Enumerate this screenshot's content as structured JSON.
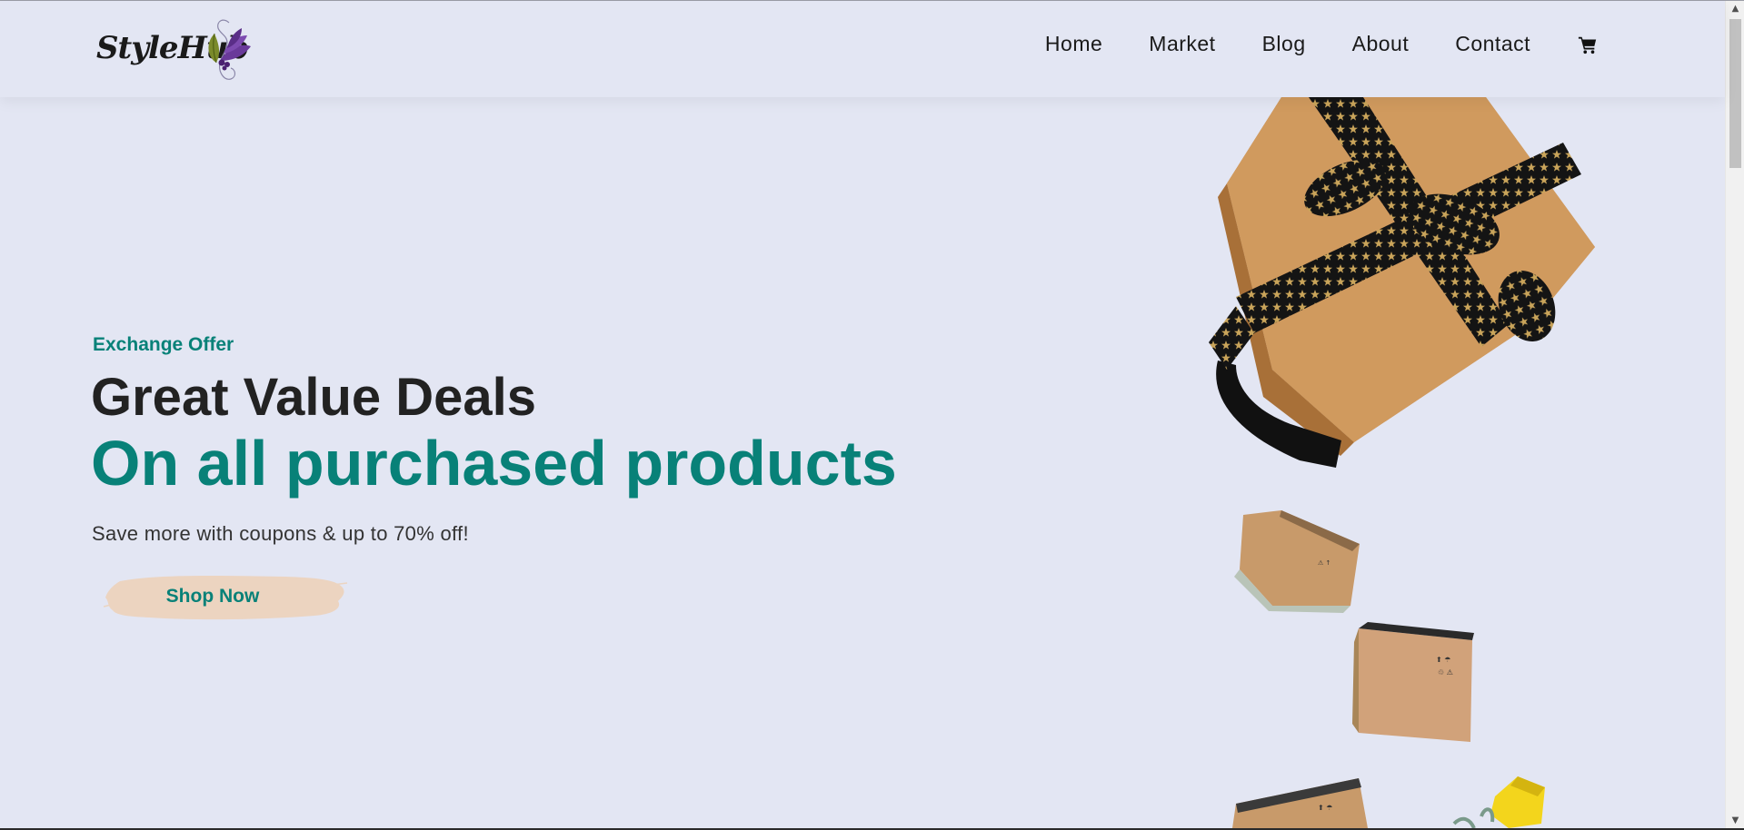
{
  "brand": {
    "logo_text": "StyleHub"
  },
  "nav": {
    "items": [
      {
        "label": "Home"
      },
      {
        "label": "Market"
      },
      {
        "label": "Blog"
      },
      {
        "label": "About"
      },
      {
        "label": "Contact"
      }
    ],
    "cart_icon": "shopping-cart-icon"
  },
  "hero": {
    "subtitle": "Exchange Offer",
    "headline": "Great Value Deals",
    "headline_accent": "On all purchased products",
    "description": "Save more with coupons & up to 70% off!",
    "cta_label": "Shop Now"
  },
  "colors": {
    "background": "#e3e6f3",
    "accent": "#088178",
    "heading": "#222222",
    "cta_brush": "#ecd4c0"
  }
}
